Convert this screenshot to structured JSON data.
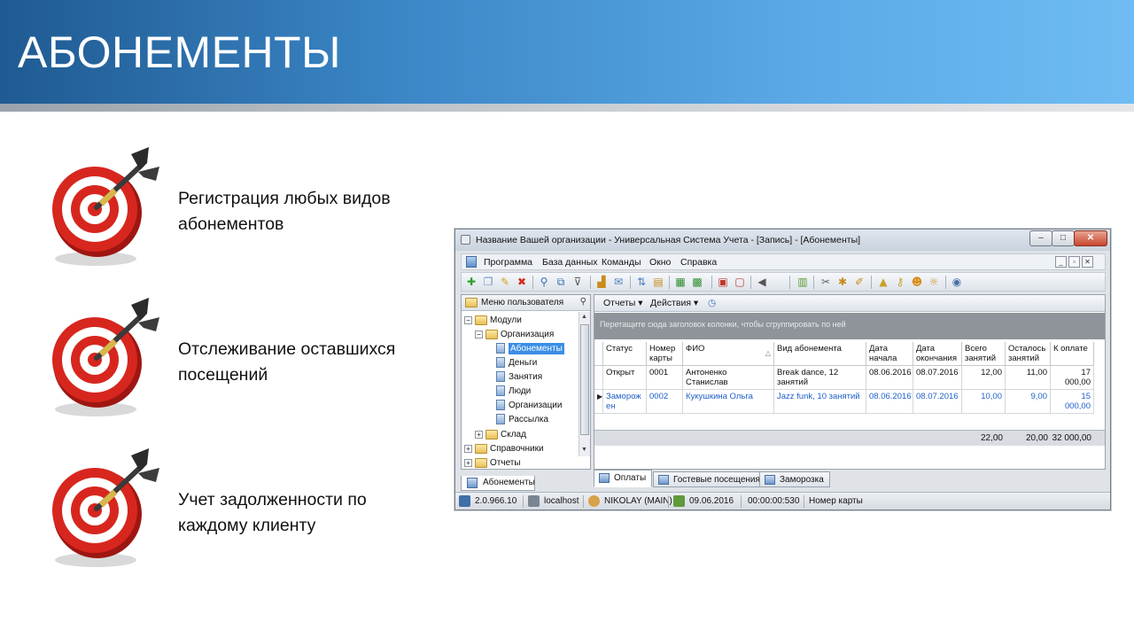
{
  "slide": {
    "title": "АБОНЕМЕНТЫ",
    "features": [
      {
        "line1": "Регистрация любых видов",
        "line2": "абонементов"
      },
      {
        "line1": "Отслеживание оставшихся",
        "line2": "посещений"
      },
      {
        "line1": "Учет задолженности по",
        "line2": "каждому клиенту"
      }
    ],
    "colors": {
      "banner_start": "#1f5a92",
      "banner_end": "#6fbcf3",
      "target_red": "#d7261e"
    }
  },
  "window": {
    "title": "Название Вашей организации - Универсальная Система Учета - [Запись] - [Абонементы]",
    "menu": [
      "Программа",
      "База данных",
      "Команды",
      "Окно",
      "Справка"
    ],
    "left_panel": {
      "title": "Меню пользователя",
      "tree": [
        {
          "label": "Модули",
          "level": 0,
          "expander": "−",
          "icon": "folder"
        },
        {
          "label": "Организация",
          "level": 1,
          "expander": "−",
          "icon": "folder-open"
        },
        {
          "label": "Абонементы",
          "level": 2,
          "icon": "doc",
          "selected": true
        },
        {
          "label": "Деньги",
          "level": 2,
          "icon": "doc"
        },
        {
          "label": "Занятия",
          "level": 2,
          "icon": "doc"
        },
        {
          "label": "Люди",
          "level": 2,
          "icon": "doc"
        },
        {
          "label": "Организации",
          "level": 2,
          "icon": "doc"
        },
        {
          "label": "Рассылка",
          "level": 2,
          "icon": "doc"
        },
        {
          "label": "Склад",
          "level": 1,
          "expander": "+",
          "icon": "folder"
        },
        {
          "label": "Справочники",
          "level": 0,
          "expander": "+",
          "icon": "folder"
        },
        {
          "label": "Отчеты",
          "level": 0,
          "expander": "+",
          "icon": "folder"
        }
      ]
    },
    "right_panel": {
      "reports_label": "Отчеты",
      "actions_label": "Действия",
      "group_hint": "Перетащите сюда заголовок колонки, чтобы сгруппировать по ней",
      "columns": [
        "Статус",
        "Номер карты",
        "ФИО",
        "Вид абонемента",
        "Дата начала",
        "Дата окончания",
        "Всего занятий",
        "Осталось занятий",
        "К оплате"
      ],
      "rows": [
        [
          "Открыт",
          "0001",
          "Антоненко Станислав",
          "Break dance, 12 занятий",
          "08.06.2016",
          "08.07.2016",
          "12,00",
          "11,00",
          "17 000,00"
        ],
        [
          "Заморожен",
          "0002",
          "Кукушкина Ольга",
          "Jazz funk, 10 занятий",
          "08.06.2016",
          "08.07.2016",
          "10,00",
          "9,00",
          "15 000,00"
        ]
      ],
      "totals": {
        "total_lessons": "22,00",
        "remaining": "20,00",
        "to_pay": "32 000,00"
      }
    },
    "bottom_tabs": [
      "Оплаты",
      "Гостевые посещения",
      "Заморозка"
    ],
    "doc_tab": "Абонементы",
    "status": {
      "version": "2.0.966.10",
      "server": "localhost",
      "user": "NIKOLAY (MAIN)",
      "date": "09.06.2016",
      "timer": "00:00:00:530",
      "field": "Номер карты"
    }
  }
}
